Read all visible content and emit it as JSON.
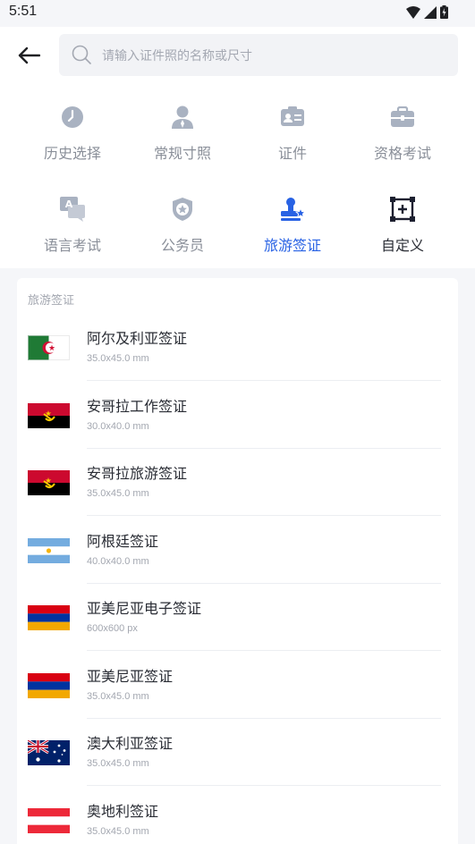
{
  "status": {
    "time": "5:51"
  },
  "search": {
    "placeholder": "请输入证件照的名称或尺寸"
  },
  "categories": [
    {
      "label": "历史选择",
      "icon": "clock-icon"
    },
    {
      "label": "常规寸照",
      "icon": "person-portrait-icon"
    },
    {
      "label": "证件",
      "icon": "id-card-icon"
    },
    {
      "label": "资格考试",
      "icon": "briefcase-icon"
    },
    {
      "label": "语言考试",
      "icon": "language-chat-icon"
    },
    {
      "label": "公务员",
      "icon": "police-badge-icon"
    },
    {
      "label": "旅游签证",
      "icon": "visa-stamp-icon",
      "active": true
    },
    {
      "label": "自定义",
      "icon": "custom-crop-icon"
    }
  ],
  "list": {
    "section_title": "旅游签证",
    "items": [
      {
        "name": "阿尔及利亚签证",
        "size": "35.0x45.0 mm",
        "flag": "algeria"
      },
      {
        "name": "安哥拉工作签证",
        "size": "30.0x40.0 mm",
        "flag": "angola"
      },
      {
        "name": "安哥拉旅游签证",
        "size": "35.0x45.0 mm",
        "flag": "angola"
      },
      {
        "name": "阿根廷签证",
        "size": "40.0x40.0 mm",
        "flag": "argentina"
      },
      {
        "name": "亚美尼亚电子签证",
        "size": "600x600 px",
        "flag": "armenia"
      },
      {
        "name": "亚美尼亚签证",
        "size": "35.0x45.0 mm",
        "flag": "armenia"
      },
      {
        "name": "澳大利亚签证",
        "size": "35.0x45.0 mm",
        "flag": "australia"
      },
      {
        "name": "奥地利签证",
        "size": "35.0x45.0 mm",
        "flag": "austria"
      }
    ]
  },
  "colors": {
    "accent": "#2862e4",
    "icon_gray": "#a9b2c1",
    "text_dark": "#2a2d35",
    "text_gray": "#8a8f99"
  }
}
